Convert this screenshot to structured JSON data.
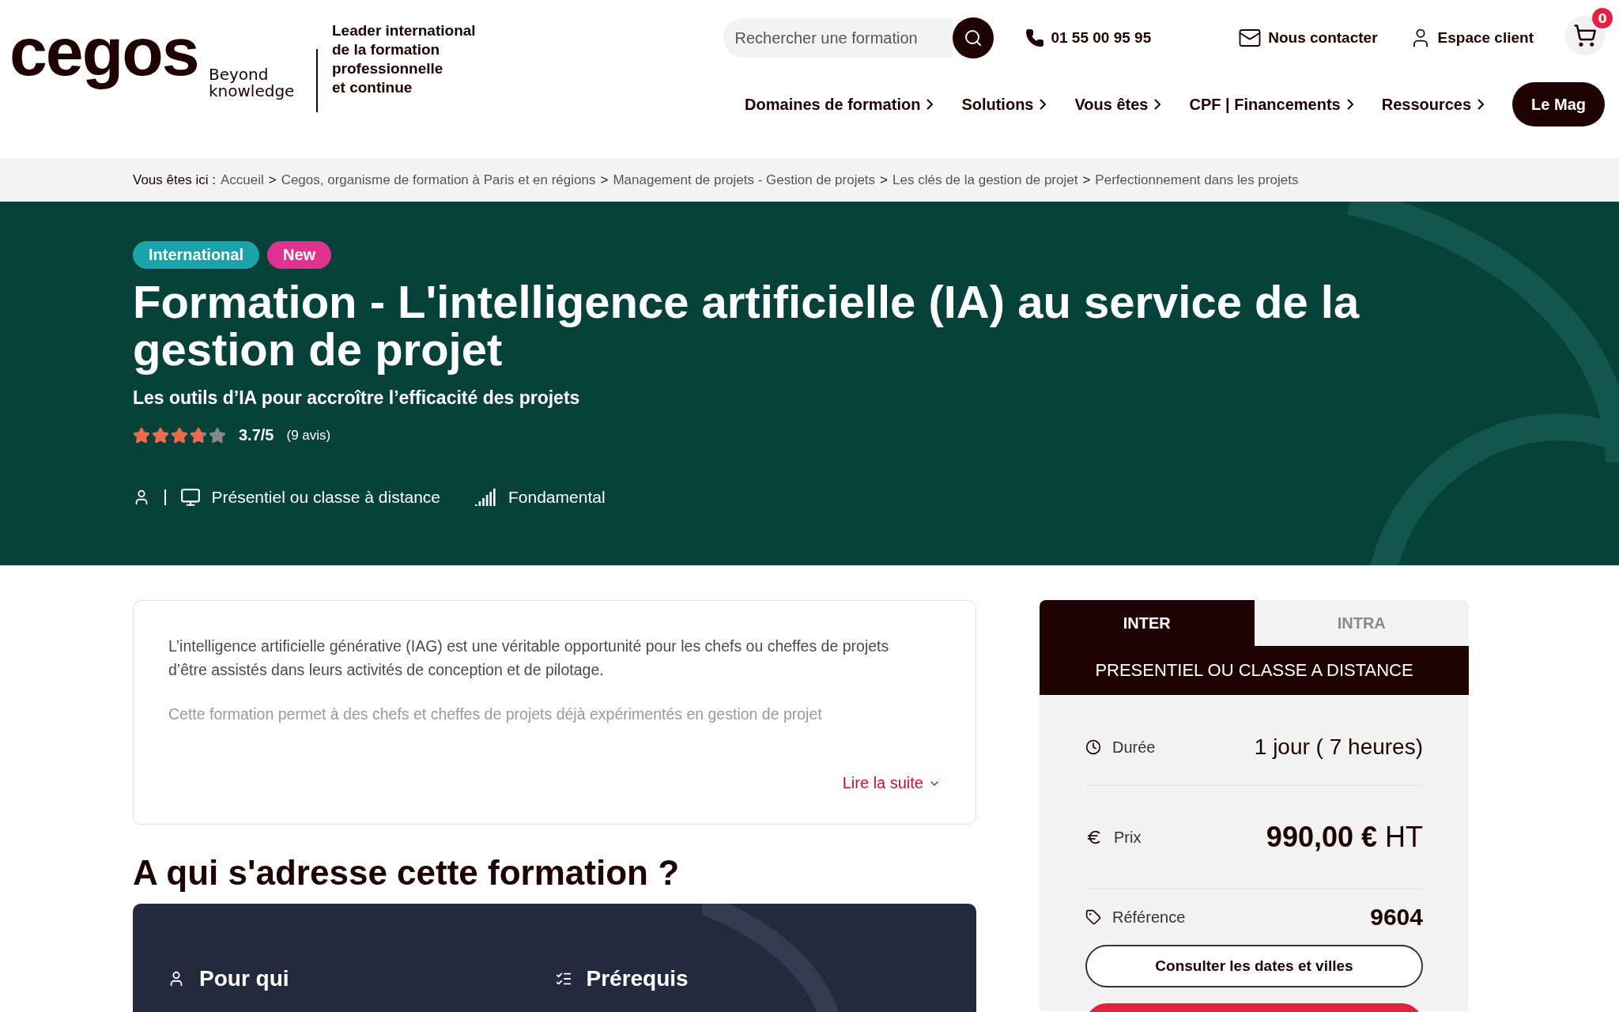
{
  "header": {
    "logo": {
      "wordmark": "cegos",
      "tagline": "Beyond knowledge"
    },
    "slogan": "Leader international\nde la formation\nprofessionnelle\net continue",
    "search": {
      "placeholder": "Rechercher une formation"
    },
    "phone": "01 55 00 95 95",
    "contact": "Nous contacter",
    "account": "Espace client",
    "cart_count": "0"
  },
  "nav": [
    {
      "label": "Domaines de formation"
    },
    {
      "label": "Solutions"
    },
    {
      "label": "Vous êtes"
    },
    {
      "label": "CPF | Financements"
    },
    {
      "label": "Ressources"
    }
  ],
  "mag_button": "Le Mag",
  "breadcrumb": {
    "prefix": "Vous êtes ici :",
    "separator": ">",
    "items": [
      "Accueil",
      "Cegos, organisme de formation à Paris et en régions",
      "Management de projets - Gestion de projets",
      "Les clés de la gestion de projet",
      "Perfectionnement dans les projets"
    ]
  },
  "hero": {
    "badges": [
      {
        "label": "International",
        "color": "#1aa3a8"
      },
      {
        "label": "New",
        "color": "#e0338f"
      }
    ],
    "title": "Formation - L'intelligence artificielle (IA) au service de la gestion de projet",
    "subtitle": "Les outils d’IA pour accroître l’efficacité des projets",
    "rating": {
      "stars": 3.7,
      "score": "3.7/5",
      "reviews": "(9 avis)"
    },
    "modality": "Présentiel ou classe à distance",
    "level": "Fondamental"
  },
  "description": {
    "paragraphs": [
      {
        "text": "L’intelligence artificielle générative (IAG) est une véritable opportunité pour les chefs ou cheffes de projets d’être assistés dans leurs activités de conception et de pilotage.",
        "faded": false
      },
      {
        "text": "Cette formation permet à des chefs et cheffes de projets déjà expérimentés en gestion de projet",
        "faded": true
      }
    ],
    "more": "Lire la suite"
  },
  "audience": {
    "heading": "A qui s'adresse cette formation ?",
    "columns": [
      {
        "title": "Pour qui",
        "kind": "person"
      },
      {
        "title": "Prérequis",
        "kind": "checklist"
      }
    ]
  },
  "offer": {
    "tabs": [
      {
        "label": "INTER",
        "selected": true
      },
      {
        "label": "INTRA",
        "selected": false
      }
    ],
    "mode": "PRESENTIEL OU CLASSE A DISTANCE",
    "rows": [
      {
        "kind": "duration",
        "label": "Durée",
        "value": "1 jour ( 7 heures)"
      },
      {
        "kind": "price",
        "label": "Prix",
        "value": "**990,00 €** HT"
      },
      {
        "kind": "reference",
        "label": "Référence",
        "value": "9604"
      }
    ],
    "dates_button": "Consulter les dates et villes"
  }
}
